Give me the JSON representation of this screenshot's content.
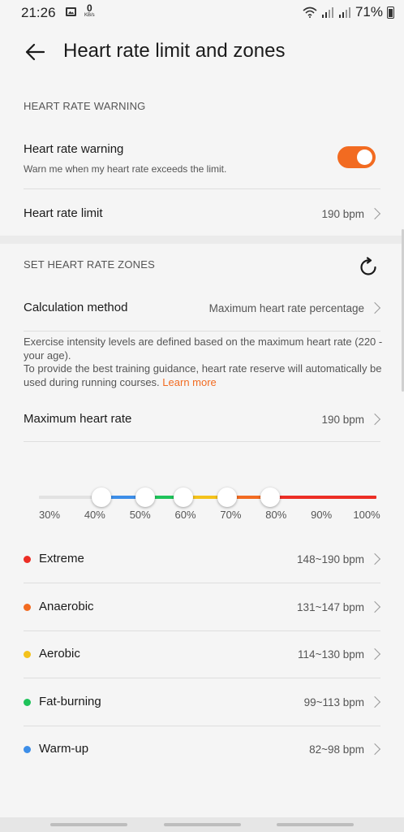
{
  "status_bar": {
    "time": "21:26",
    "kb_value": "0",
    "kb_unit": "KB/s",
    "battery": "71%",
    "icons": [
      "image-icon",
      "wifi-icon",
      "signal-icon",
      "signal-icon",
      "battery-icon"
    ]
  },
  "header": {
    "title": "Heart rate limit and zones",
    "back_icon": "back-arrow-icon"
  },
  "warning_section": {
    "label": "HEART RATE WARNING",
    "warning_title": "Heart rate warning",
    "warning_desc": "Warn me when my heart rate exceeds the limit.",
    "warning_enabled": true,
    "limit_title": "Heart rate limit",
    "limit_value": "190 bpm"
  },
  "zones_section": {
    "label": "SET HEART RATE ZONES",
    "reset_icon": "refresh-icon",
    "method_title": "Calculation method",
    "method_value": "Maximum heart rate percentage",
    "desc_line1": "Exercise intensity levels are defined based on the maximum heart rate (220 - your age).",
    "desc_line2": "To provide the best training guidance, heart rate reserve will automatically be used during running courses.",
    "learn_more": "Learn more",
    "max_title": "Maximum heart rate",
    "max_value": "190 bpm"
  },
  "slider": {
    "ticks": [
      "30%",
      "40%",
      "50%",
      "60%",
      "70%",
      "80%",
      "90%",
      "100%"
    ],
    "thumbs_percent": [
      43,
      52,
      60,
      69,
      78
    ],
    "segment_colors": [
      "#e2e2e2",
      "#3d8ee8",
      "#1fc35a",
      "#f4c21b",
      "#f26b21",
      "#ec2e25"
    ]
  },
  "zones": [
    {
      "name": "Extreme",
      "range": "148~190 bpm",
      "color": "#ec2e25"
    },
    {
      "name": "Anaerobic",
      "range": "131~147 bpm",
      "color": "#f26b21"
    },
    {
      "name": "Aerobic",
      "range": "114~130 bpm",
      "color": "#f4c21b"
    },
    {
      "name": "Fat-burning",
      "range": "99~113 bpm",
      "color": "#1fc35a"
    },
    {
      "name": "Warm-up",
      "range": "82~98 bpm",
      "color": "#3d8ee8"
    }
  ]
}
